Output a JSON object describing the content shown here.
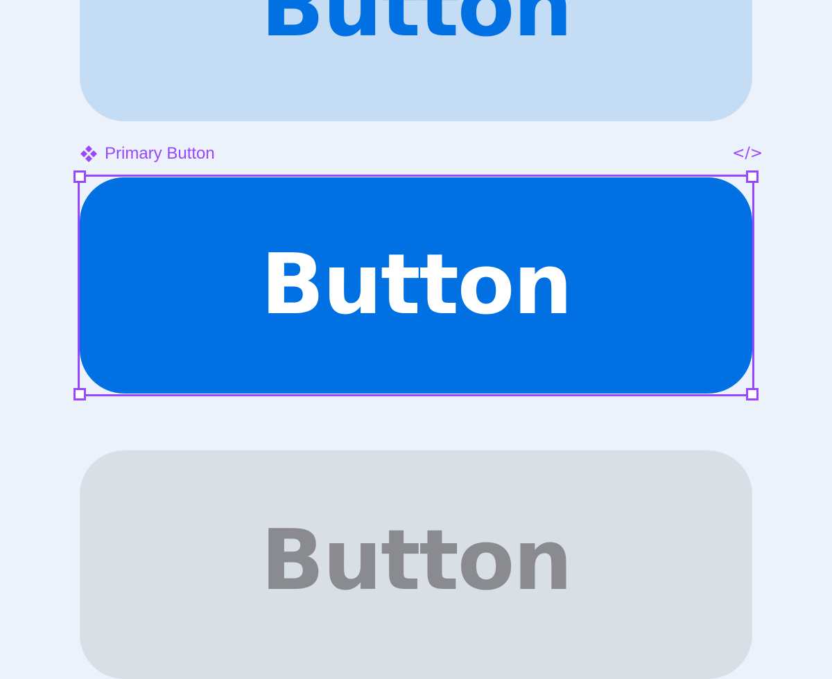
{
  "colors": {
    "canvas_bg": "#ebf2fb",
    "selection": "#9747ff",
    "secondary_bg": "#c4ddf5",
    "secondary_text": "#0070e3",
    "primary_bg": "#0070e3",
    "primary_text": "#ffffff",
    "disabled_bg": "#d9dfe7",
    "disabled_text": "#8a8b90"
  },
  "buttons": {
    "secondary": {
      "label": "Button"
    },
    "primary": {
      "label": "Button"
    },
    "disabled": {
      "label": "Button"
    }
  },
  "selection": {
    "component_icon": "component-diamonds-icon",
    "component_name": "Primary Button",
    "code_icon": "</>"
  }
}
